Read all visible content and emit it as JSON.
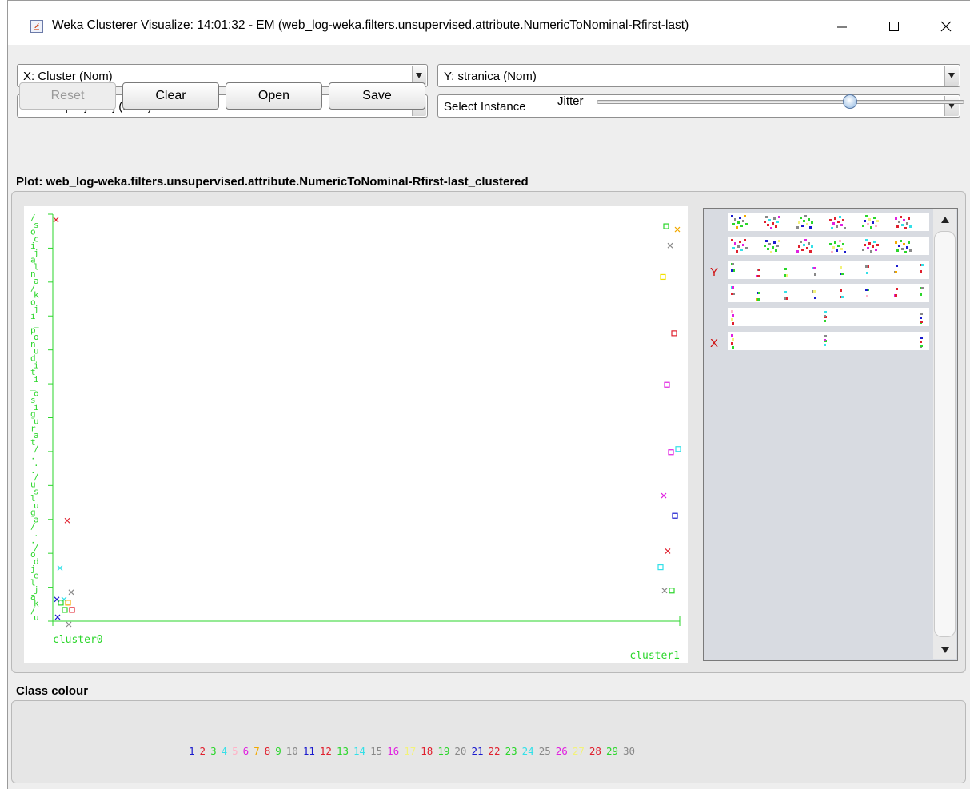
{
  "window": {
    "title": "Weka Clusterer Visualize: 14:01:32 - EM (web_log-weka.filters.unsupervised.attribute.NumericToNominal-Rfirst-last)"
  },
  "controls": {
    "x_select": "X: Cluster (Nom)",
    "y_select": "Y: stranica (Nom)",
    "colour_select": "Colour: posjetitelj (Nom)",
    "instance_select": "Select Instance",
    "buttons": {
      "reset": "Reset",
      "clear": "Clear",
      "open": "Open",
      "save": "Save"
    },
    "jitter_label": "Jitter",
    "jitter_value": 0.67
  },
  "plot": {
    "title": "Plot: web_log-weka.filters.unsupervised.attribute.NumericToNominal-Rfirst-last_clustered",
    "x_labels": [
      "cluster0",
      "cluster1"
    ],
    "y_axis_text": "/socijalna/koji_ponuditi_osigurat/.../usluga/../odjeljak/u"
  },
  "chart_data": {
    "type": "scatter",
    "title": "Plot: web_log-weka.filters.unsupervised.attribute.NumericToNominal-Rfirst-last_clustered",
    "xlabel": "Cluster",
    "ylabel": "stranica",
    "categories": [
      "cluster0",
      "cluster1"
    ],
    "grid": false,
    "note_legend": "colour by posjetitelj (1-30)",
    "points": [
      {
        "x": "cluster0",
        "y": 0.99,
        "c": "#e0202e",
        "m": "x"
      },
      {
        "x": "cluster0",
        "y": 0.25,
        "c": "#e0202e",
        "m": "x"
      },
      {
        "x": "cluster0",
        "y": 0.14,
        "c": "#33e0e8",
        "m": "x"
      },
      {
        "x": "cluster0",
        "y": 0.07,
        "c": "#888",
        "m": "x"
      },
      {
        "x": "cluster0",
        "y": 0.06,
        "c": "#33e0e8",
        "m": "x"
      },
      {
        "x": "cluster0",
        "y": 0.05,
        "c": "#1a1acd",
        "m": "x"
      },
      {
        "x": "cluster0",
        "y": 0.05,
        "c": "#f2a900",
        "m": "s"
      },
      {
        "x": "cluster0",
        "y": 0.04,
        "c": "#2bd62b",
        "m": "s"
      },
      {
        "x": "cluster0",
        "y": 0.03,
        "c": "#e0202e",
        "m": "s"
      },
      {
        "x": "cluster0",
        "y": 0.02,
        "c": "#2bd62b",
        "m": "s"
      },
      {
        "x": "cluster0",
        "y": 0.01,
        "c": "#1a1acd",
        "m": "x"
      },
      {
        "x": "cluster0",
        "y": 0.0,
        "c": "#888",
        "m": "x"
      },
      {
        "x": "cluster1",
        "y": 0.98,
        "c": "#2bd62b",
        "m": "s"
      },
      {
        "x": "cluster1",
        "y": 0.98,
        "c": "#f2a900",
        "m": "x"
      },
      {
        "x": "cluster1",
        "y": 0.93,
        "c": "#888",
        "m": "x"
      },
      {
        "x": "cluster1",
        "y": 0.86,
        "c": "#f2e000",
        "m": "s"
      },
      {
        "x": "cluster1",
        "y": 0.71,
        "c": "#e0202e",
        "m": "s"
      },
      {
        "x": "cluster1",
        "y": 0.59,
        "c": "#e020e0",
        "m": "s"
      },
      {
        "x": "cluster1",
        "y": 0.42,
        "c": "#33e0e8",
        "m": "s"
      },
      {
        "x": "cluster1",
        "y": 0.42,
        "c": "#e020e0",
        "m": "s"
      },
      {
        "x": "cluster1",
        "y": 0.32,
        "c": "#e020e0",
        "m": "x"
      },
      {
        "x": "cluster1",
        "y": 0.26,
        "c": "#1a1acd",
        "m": "s"
      },
      {
        "x": "cluster1",
        "y": 0.18,
        "c": "#e0202e",
        "m": "x"
      },
      {
        "x": "cluster1",
        "y": 0.13,
        "c": "#33e0e8",
        "m": "s"
      },
      {
        "x": "cluster1",
        "y": 0.08,
        "c": "#2bd62b",
        "m": "s"
      },
      {
        "x": "cluster1",
        "y": 0.07,
        "c": "#888",
        "m": "x"
      }
    ]
  },
  "mini_matrix": {
    "y_marker": "Y",
    "x_marker": "X"
  },
  "class_colour": {
    "title": "Class colour",
    "items": [
      {
        "label": "1",
        "color": "#1a1acd"
      },
      {
        "label": "2",
        "color": "#e0202e"
      },
      {
        "label": "3",
        "color": "#2bd62b"
      },
      {
        "label": "4",
        "color": "#33e0e8"
      },
      {
        "label": "5",
        "color": "#ffb3c8"
      },
      {
        "label": "6",
        "color": "#e020e0"
      },
      {
        "label": "7",
        "color": "#f2a900"
      },
      {
        "label": "8",
        "color": "#e0202e"
      },
      {
        "label": "9",
        "color": "#2bd62b"
      },
      {
        "label": "10",
        "color": "#888888"
      },
      {
        "label": "11",
        "color": "#1a1acd"
      },
      {
        "label": "12",
        "color": "#e0202e"
      },
      {
        "label": "13",
        "color": "#2bd62b"
      },
      {
        "label": "14",
        "color": "#33e0e8"
      },
      {
        "label": "15",
        "color": "#888888"
      },
      {
        "label": "16",
        "color": "#e020e0"
      },
      {
        "label": "17",
        "color": "#f2f27a"
      },
      {
        "label": "18",
        "color": "#e0202e"
      },
      {
        "label": "19",
        "color": "#2bd62b"
      },
      {
        "label": "20",
        "color": "#888888"
      },
      {
        "label": "21",
        "color": "#1a1acd"
      },
      {
        "label": "22",
        "color": "#e0202e"
      },
      {
        "label": "23",
        "color": "#2bd62b"
      },
      {
        "label": "24",
        "color": "#33e0e8"
      },
      {
        "label": "25",
        "color": "#888888"
      },
      {
        "label": "26",
        "color": "#e020e0"
      },
      {
        "label": "27",
        "color": "#f2f27a"
      },
      {
        "label": "28",
        "color": "#e0202e"
      },
      {
        "label": "29",
        "color": "#2bd62b"
      },
      {
        "label": "30",
        "color": "#888888"
      }
    ]
  }
}
